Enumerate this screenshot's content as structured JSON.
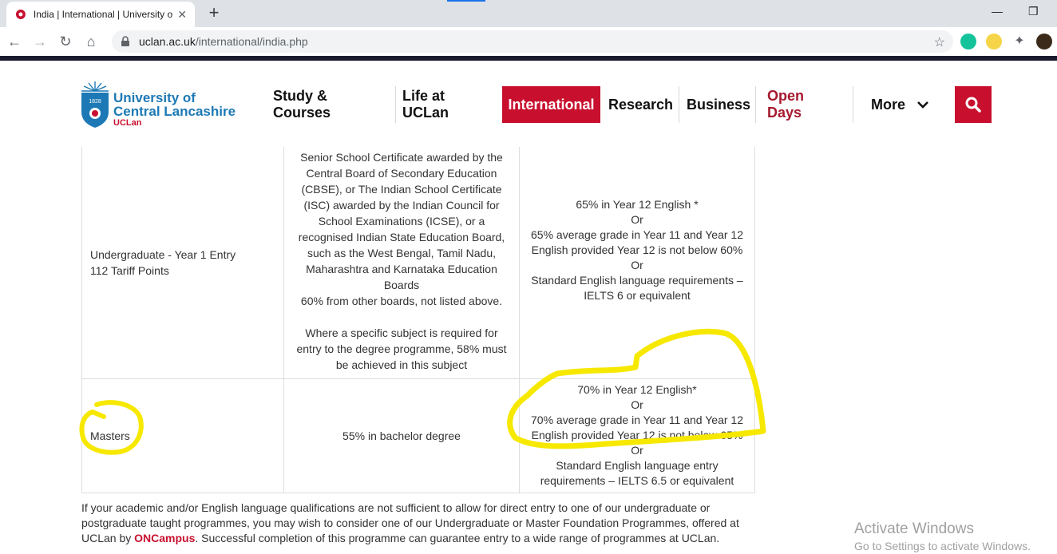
{
  "browser": {
    "tab_title": "India | International | University of Central Lancashire",
    "url_host": "uclan.ac.uk",
    "url_path": "/international/india.php"
  },
  "site": {
    "logo": {
      "line1": "University of",
      "line2": "Central Lancashire",
      "short": "UCLan",
      "year": "1828"
    },
    "nav": [
      {
        "label": "Study & Courses"
      },
      {
        "label": "Life at UCLan"
      },
      {
        "label": "International"
      },
      {
        "label": "Research"
      },
      {
        "label": "Business"
      },
      {
        "label": "Open Days"
      },
      {
        "label": "More"
      }
    ],
    "brand_red": "#c8102e",
    "brand_blue": "#1d79b5"
  },
  "table": {
    "rows": [
      {
        "level": [
          "Undergraduate - Year 1 Entry",
          "112 Tariff Points"
        ],
        "academic": [
          "Senior School Certificate awarded by the",
          "Central Board of Secondary Education",
          "(CBSE), or The Indian School Certificate",
          "(ISC) awarded by the Indian Council for",
          "School Examinations (ICSE), or a",
          "recognised Indian State Education Board,",
          "such as the West Bengal, Tamil Nadu,",
          "Maharashtra and Karnataka Education",
          "Boards",
          "60% from other boards, not listed above.",
          "",
          "Where a specific subject is required for",
          "entry to the degree programme, 58% must",
          "be achieved in this subject"
        ],
        "english": [
          "65% in Year 12 English *",
          "Or",
          "65% average grade in Year 11 and Year 12",
          "English provided Year 12 is not below 60%",
          "Or",
          "Standard English language requirements –",
          "IELTS 6 or equivalent"
        ]
      },
      {
        "level": [
          "Masters"
        ],
        "academic": [
          "55% in bachelor degree"
        ],
        "english": [
          "70% in Year 12 English*",
          "Or",
          "70% average grade in Year 11 and Year 12",
          "English provided Year 12 is not below 65%",
          "Or",
          "Standard English language entry",
          "requirements – IELTS 6.5 or equivalent"
        ]
      }
    ]
  },
  "note": {
    "before": "If your academic and/or English language qualifications are not sufficient to allow for direct entry to one of our undergraduate or postgraduate taught programmes, you may wish to consider one of our Undergraduate or Master Foundation Programmes, offered at UCLan by ",
    "brand": "ONCampus",
    "after": ". Successful completion of this programme can guarantee entry to a wide range of programmes at UCLan."
  },
  "watermark": {
    "line1": "Activate Windows",
    "line2": "Go to Settings to activate Windows."
  },
  "annotation_color": "#f7e800"
}
